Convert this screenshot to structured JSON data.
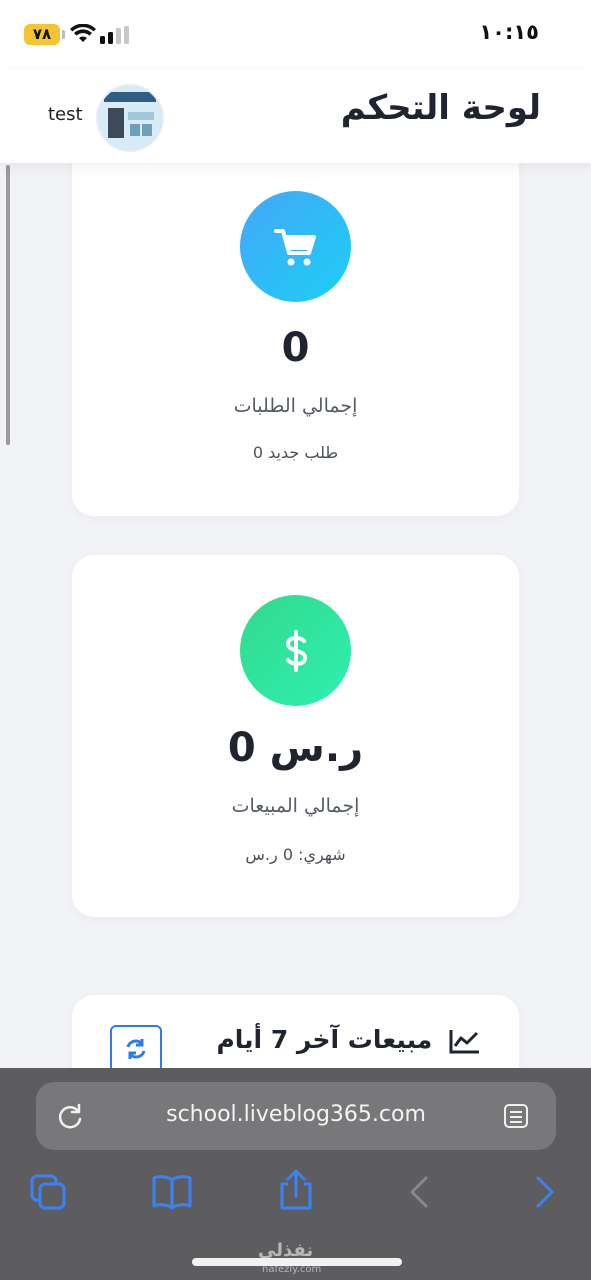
{
  "status_bar": {
    "time": "١٠:١٥",
    "battery": "٧٨"
  },
  "header": {
    "title": "لوحة التحكم",
    "username": "test"
  },
  "cards": {
    "orders": {
      "value": "0",
      "label": "إجمالي الطلبات",
      "sub": "0 طلب جديد",
      "icon": "cart-icon",
      "color": "#2fb8f6"
    },
    "sales": {
      "value": "0 ر.س",
      "label": "إجمالي المبيعات",
      "sub": "شهري: 0 ر.س",
      "icon": "dollar-icon",
      "color": "#33e19e"
    }
  },
  "chart_section": {
    "title": "مبيعات آخر 7 أيام",
    "icon": "chart-line-icon",
    "refresh_icon": "refresh-icon"
  },
  "browser": {
    "url": "school.liveblog365.com",
    "accent": "#3b82f6"
  },
  "watermark": {
    "text": "نفذلي",
    "sub": "nafezly.com"
  }
}
